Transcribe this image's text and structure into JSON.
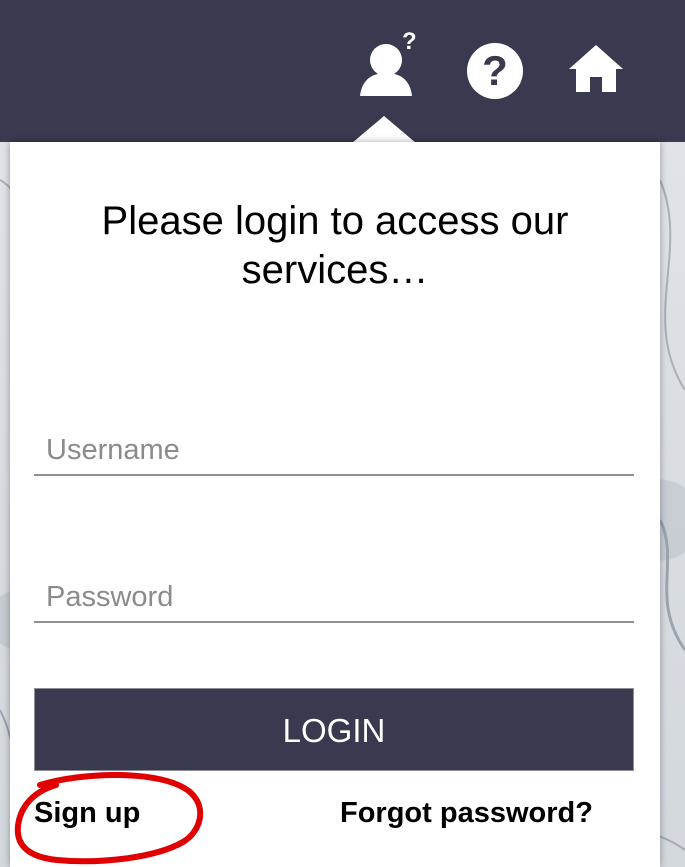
{
  "header": {
    "account_icon": "account-question-icon",
    "help_icon": "help-circle-icon",
    "home_icon": "home-icon",
    "background_color": "#39394f"
  },
  "login_panel": {
    "title": "Please login to access our services…",
    "username": {
      "value": "",
      "placeholder": "Username"
    },
    "password": {
      "value": "",
      "placeholder": "Password"
    },
    "login_label": "LOGIN",
    "sign_up_label": "Sign up",
    "forgot_password_label": "Forgot password?",
    "primary_color": "#39394f"
  },
  "annotation": {
    "shape": "ellipse",
    "target": "Sign up",
    "color": "#e00000"
  }
}
